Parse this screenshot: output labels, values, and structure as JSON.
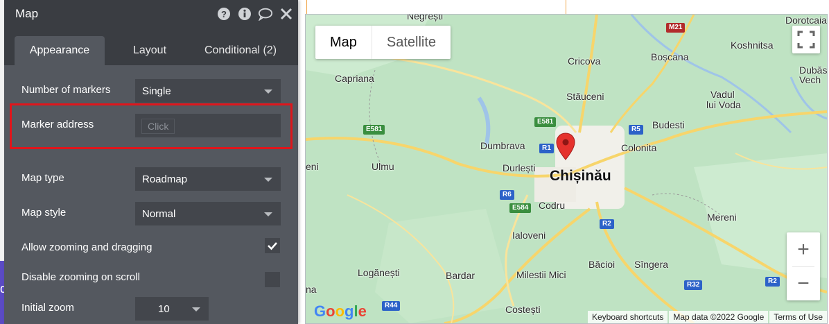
{
  "panel": {
    "title": "Map",
    "tabs": [
      {
        "label": "Appearance",
        "active": true
      },
      {
        "label": "Layout",
        "active": false
      },
      {
        "label": "Conditional (2)",
        "active": false
      }
    ],
    "fields": {
      "number_of_markers": {
        "label": "Number of markers",
        "value": "Single"
      },
      "marker_address": {
        "label": "Marker address",
        "placeholder": "Click"
      },
      "map_type": {
        "label": "Map type",
        "value": "Roadmap"
      },
      "map_style": {
        "label": "Map style",
        "value": "Normal"
      },
      "allow_zooming": {
        "label": "Allow zooming and dragging",
        "checked": true
      },
      "disable_zoom_scroll": {
        "label": "Disable zooming on scroll",
        "checked": false
      },
      "initial_zoom": {
        "label": "Initial zoom",
        "value": "10"
      }
    },
    "header_icons": [
      "help-icon",
      "info-icon",
      "comment-icon",
      "close-icon"
    ],
    "colors": {
      "panel_bg": "#54585f",
      "header_bg": "#3a3d42",
      "field_bg": "#43464c",
      "highlight": "#e0151b"
    }
  },
  "map": {
    "toggle": {
      "map": "Map",
      "satellite": "Satellite"
    },
    "places": {
      "negresti": "Negrești",
      "dorotcaia": "Dorotcaia",
      "coshnitsa": "Koshnitsa",
      "capriana": "Capriana",
      "cricova": "Cricova",
      "boscana": "Boșcana",
      "dubasari": "Dubăsa",
      "vech": "Vech",
      "staueni": "Stăuceni",
      "vadul": "Vadul",
      "lui_voda": "lui Voda",
      "budesti": "Budesti",
      "dumbrava": "Dumbrava",
      "colonita": "Colonita",
      "eni": "eni",
      "ulmu": "Ulmu",
      "durlesti": "Durlești",
      "chisinau": "Chișinău",
      "codru": "Codru",
      "mereni": "Mereni",
      "ialoveni": "Ialoveni",
      "loganesti": "Logănești",
      "bardar": "Bardar",
      "milestii": "Milestii Mici",
      "bacioi": "Băcioi",
      "singera": "Sîngera",
      "na": "na",
      "costesti": "Costești"
    },
    "shields": {
      "m21": "M21",
      "e581a": "E581",
      "e581b": "E581",
      "r1": "R1",
      "r5": "R5",
      "r6": "R6",
      "e584": "E584",
      "r2a": "R2",
      "r2b": "R2",
      "r32": "R32",
      "r44": "R44"
    },
    "attribution": {
      "shortcuts": "Keyboard shortcuts",
      "data": "Map data ©2022 Google",
      "terms": "Terms of Use"
    },
    "logo": "Google",
    "zoom_in": "+",
    "zoom_out": "−"
  },
  "editor": {
    "left_badge": "d"
  }
}
